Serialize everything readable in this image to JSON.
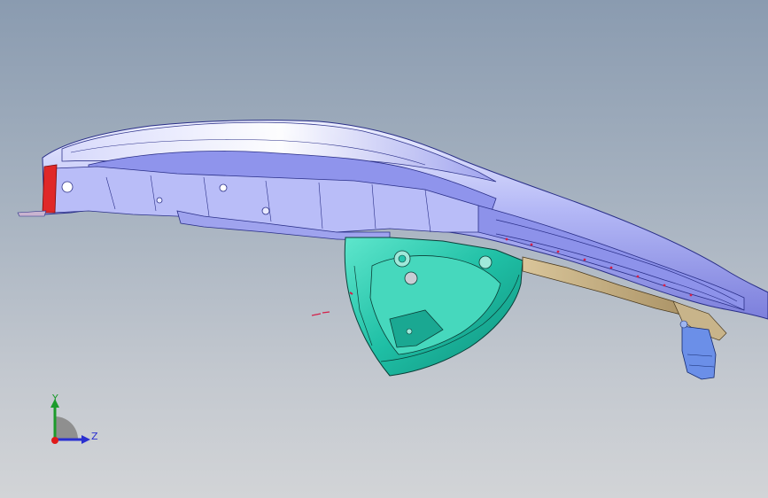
{
  "viewport": {
    "background_top": "#8a9bb0",
    "background_bottom": "#d2d4d7"
  },
  "model": {
    "name": "",
    "parts": [
      {
        "part": "upper-rail-body",
        "color": "#a7abf5"
      },
      {
        "part": "wheelhouse-panel",
        "color": "#25c7ae"
      },
      {
        "part": "lower-bracket",
        "color": "#c8b48a"
      },
      {
        "part": "end-bracket",
        "color": "#5a7fe0"
      },
      {
        "part": "red-end-cap",
        "color": "#e02828"
      }
    ]
  },
  "triad": {
    "y_label": "Y",
    "z_label": "Z",
    "y_color": "#1c9b2b",
    "z_color": "#2a2fd0",
    "x_color": "#e01a1a",
    "cone_color": "#8f8f8f"
  }
}
